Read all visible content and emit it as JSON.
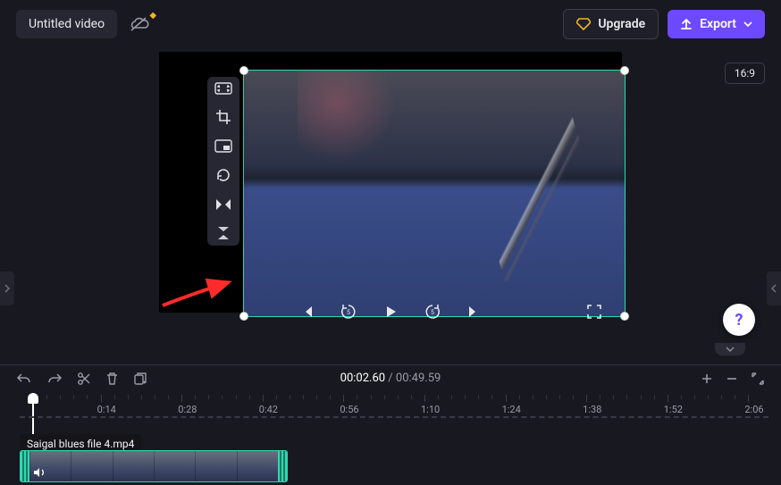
{
  "header": {
    "title": "Untitled video",
    "upgrade_label": "Upgrade",
    "export_label": "Export",
    "aspect_ratio": "16:9"
  },
  "toolbox": {
    "fit": "fit-icon",
    "crop": "crop-icon",
    "pip": "pip-icon",
    "rotate": "rotate-icon",
    "flip_h": "flip-horizontal-icon",
    "flip_v": "flip-vertical-icon"
  },
  "transport": {
    "current_time": "00:02",
    "current_frames": ".60",
    "sep": " / ",
    "total_time": "00:49",
    "total_frames": ".59"
  },
  "timeline": {
    "ruler_labels": [
      "0:14",
      "0:28",
      "0:42",
      "0:56",
      "1:10",
      "1:24",
      "1:38",
      "1:52",
      "2:06"
    ],
    "clip_filename": "Saigal blues file 4.mp4"
  },
  "help_label": "?"
}
